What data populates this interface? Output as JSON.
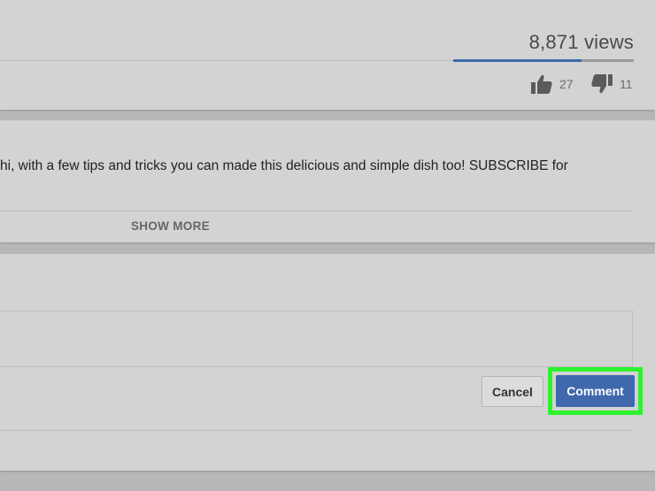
{
  "stats": {
    "views": "8,871 views",
    "likes": "27",
    "dislikes": "11",
    "like_ratio": 0.71
  },
  "description": {
    "text": "hi, with a few tips and tricks you can made this delicious and simple dish too! SUBSCRIBE for",
    "show_more_label": "SHOW MORE"
  },
  "comment_form": {
    "cancel_label": "Cancel",
    "submit_label": "Comment"
  },
  "colors": {
    "accent": "#3f68ad",
    "highlight": "#2df22d",
    "background": "#d3d3d3"
  },
  "icons": [
    "thumbs-up-icon",
    "thumbs-down-icon"
  ]
}
